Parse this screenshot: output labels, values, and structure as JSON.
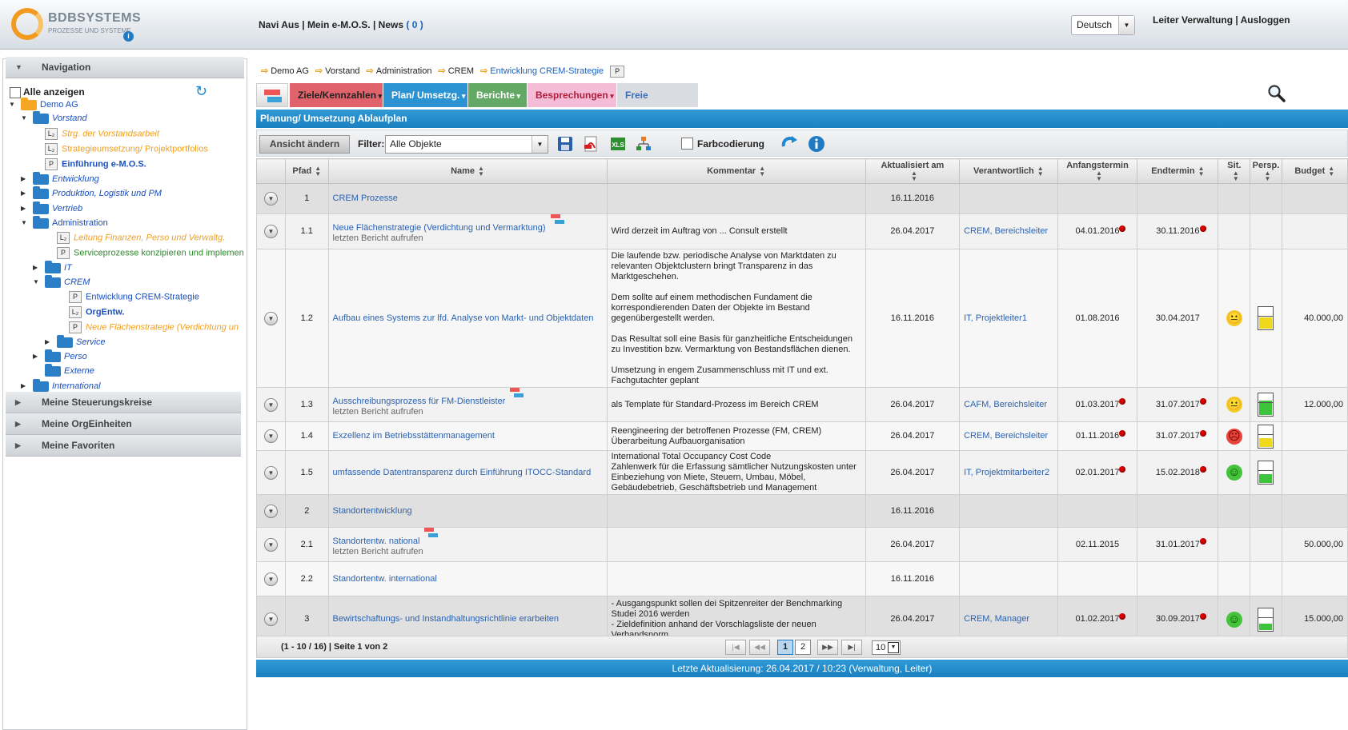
{
  "header": {
    "logo_text": "BDBSYSTEMS",
    "logo_sub": "PROZESSE UND SYSTEME",
    "nav": {
      "navi_aus": "Navi Aus",
      "sep1": " | ",
      "mein": "Mein e-M.O.S.",
      "sep2": " | ",
      "news": "News",
      "news_count": "( 0 )"
    },
    "language": "Deutsch",
    "user": "Leiter Verwaltung",
    "user_sep": " | ",
    "logout": "Ausloggen"
  },
  "sidebar": {
    "nav_title": "Navigation",
    "show_all": "Alle anzeigen",
    "tree": [
      {
        "label": "Demo AG",
        "type": "folder-orange",
        "color": "blue",
        "toggle": "▼"
      },
      {
        "label": "Vorstand",
        "type": "folder",
        "color": "blue-i",
        "toggle": "▼"
      },
      {
        "label": "Strg. der Vorstandsarbeit",
        "type": "L",
        "color": "orange"
      },
      {
        "label": "Strategieumsetzung/ Projektportfolios",
        "type": "L",
        "color": "orange-n"
      },
      {
        "label": "Einführung e-M.O.S.",
        "type": "P",
        "color": "blue-b"
      },
      {
        "label": "Entwicklung",
        "type": "folder",
        "color": "blue-i",
        "toggle": "▶"
      },
      {
        "label": "Produktion, Logistik und PM",
        "type": "folder",
        "color": "blue-i",
        "toggle": "▶"
      },
      {
        "label": "Vertrieb",
        "type": "folder",
        "color": "blue-i",
        "toggle": "▶"
      },
      {
        "label": "Administration",
        "type": "folder",
        "color": "blue-n",
        "toggle": "▼"
      },
      {
        "label": "Leitung Finanzen, Perso und Verwaltg.",
        "type": "L",
        "color": "orange"
      },
      {
        "label": "Serviceprozesse konzipieren und implemen",
        "type": "P",
        "color": "green"
      },
      {
        "label": "IT",
        "type": "folder",
        "color": "blue-i",
        "toggle": "▶"
      },
      {
        "label": "CREM",
        "type": "folder",
        "color": "blue-i",
        "toggle": "▼"
      },
      {
        "label": "Entwicklung CREM-Strategie",
        "type": "P",
        "color": "blue-n"
      },
      {
        "label": "OrgEntw.",
        "type": "L",
        "color": "blue-b"
      },
      {
        "label": "Neue Flächenstrategie (Verdichtung un",
        "type": "P",
        "color": "orange"
      },
      {
        "label": "Service",
        "type": "folder",
        "color": "blue-i",
        "toggle": "▶"
      },
      {
        "label": "Perso",
        "type": "folder",
        "color": "blue-i",
        "toggle": "▶"
      },
      {
        "label": "Externe",
        "type": "folder",
        "color": "blue-i",
        "toggle": ""
      },
      {
        "label": "International",
        "type": "folder",
        "color": "blue-i",
        "toggle": "▶"
      }
    ],
    "sections": [
      "Meine Steuerungskreise",
      "Meine OrgEinheiten",
      "Meine Favoriten"
    ]
  },
  "breadcrumb": [
    "Demo AG",
    "Vorstand",
    "Administration",
    "CREM",
    "Entwicklung CREM-Strategie"
  ],
  "breadcrumb_doc": "P",
  "menu": [
    {
      "label": "Ziele/Kennzahlen",
      "color": "#e0626a"
    },
    {
      "label": "Plan/ Umsetzg.",
      "color": "#2c93d3"
    },
    {
      "label": "Berichte",
      "color": "#64a866"
    },
    {
      "label": "Besprechungen",
      "color": "#f4bcd6"
    },
    {
      "label": "Freie Dokumente",
      "color": "#d9dde2"
    }
  ],
  "panel_title": "Planung/ Umsetzung Ablaufplan",
  "toolbar": {
    "view_button": "Ansicht ändern",
    "filter_label": "Filter:",
    "filter_value": "Alle Objekte",
    "color_coding": "Farbcodierung",
    "xls": "XLS"
  },
  "columns": [
    "Pfad",
    "Name",
    "Kommentar",
    "Aktualisiert am",
    "Verantwortlich",
    "Anfangstermin",
    "Endtermin",
    "Sit.",
    "Persp.",
    "Budget"
  ],
  "rows": [
    {
      "path": "1",
      "name": "CREM Prozesse",
      "sub": "",
      "comment": "",
      "updated": "16.11.2016",
      "resp": "",
      "start": "",
      "end": "",
      "sit": "",
      "gauge": "",
      "budget": "",
      "group": true
    },
    {
      "path": "1.1",
      "name": "Neue Flächenstrategie (Verdichtung und Vermarktung)",
      "sub": "letzten Bericht aufrufen",
      "comment": "Wird derzeit im Auftrag von ... Consult erstellt",
      "updated": "26.04.2017",
      "resp": "CREM, Bereichsleiter",
      "start": "04.01.2016",
      "start_dot": true,
      "end": "30.11.2016",
      "end_dot": true,
      "sit": "",
      "gauge": "",
      "budget": ""
    },
    {
      "path": "1.2",
      "name": "Aufbau eines Systems zur lfd. Analyse von Markt- und Objektdaten",
      "sub": "",
      "comment": "Die laufende bzw. periodische Analyse von Marktdaten zu relevanten Objektclustern bringt Transparenz in das Marktgeschehen.\n\nDem sollte auf einem methodischen Fundament die korrespondierenden Daten der Objekte im Bestand gegenübergestellt werden.\n\nDas Resultat soll eine Basis für ganzheitliche Entscheidungen zu Investition bzw. Vermarktung von Bestandsflächen dienen.\n\nUmsetzung in engem Zusammenschluss mit IT und ext. Fachgutachter geplant",
      "updated": "16.11.2016",
      "resp": "IT, Projektleiter1",
      "start": "01.08.2016",
      "end": "30.04.2017",
      "sit": "yellow",
      "gauge": "yellow",
      "gauge_level": 0.5,
      "budget": "40.000,00"
    },
    {
      "path": "1.3",
      "name": "Ausschreibungsprozess für FM-Dienstleister",
      "sub": "letzten Bericht aufrufen",
      "comment": "als Template für Standard-Prozess im Bereich CREM",
      "updated": "26.04.2017",
      "resp": "CAFM, Bereichsleiter",
      "start": "01.03.2017",
      "start_dot": true,
      "end": "31.07.2017",
      "end_dot": true,
      "sit": "yellow",
      "gauge": "green",
      "gauge_level": 0.65,
      "budget": "12.000,00"
    },
    {
      "path": "1.4",
      "name": "Exzellenz im Betriebsstättenmanagement",
      "sub": "",
      "comment": "Reengineering der betroffenen Prozesse (FM, CREM)\nÜberarbeitung Aufbauorganisation",
      "updated": "26.04.2017",
      "resp": "CREM, Bereichsleiter",
      "start": "01.11.2016",
      "start_dot": true,
      "end": "31.07.2017",
      "end_dot": true,
      "sit": "red",
      "gauge": "yellow",
      "gauge_level": 0.4,
      "budget": ""
    },
    {
      "path": "1.5",
      "name": "umfassende Datentransparenz durch Einführung ITOCC-Standard",
      "sub": "",
      "comment": "International Total Occupancy Cost Code\nZahlenwerk für die Erfassung sämtlicher Nutzungskosten unter Einbeziehung von Miete, Steuern, Umbau, Möbel, Gebäudebetrieb, Geschäftsbetrieb und Management",
      "updated": "26.04.2017",
      "resp": "IT, Projektmitarbeiter2",
      "start": "02.01.2017",
      "start_dot": true,
      "end": "15.02.2018",
      "end_dot": true,
      "sit": "green",
      "gauge": "green",
      "gauge_level": 0.4,
      "budget": ""
    },
    {
      "path": "2",
      "name": "Standortentwicklung",
      "sub": "",
      "comment": "",
      "updated": "16.11.2016",
      "resp": "",
      "start": "",
      "end": "",
      "sit": "",
      "gauge": "",
      "budget": "",
      "group": true
    },
    {
      "path": "2.1",
      "name": "Standortentw. national",
      "sub": "letzten Bericht aufrufen",
      "comment": "",
      "updated": "26.04.2017",
      "resp": "",
      "start": "02.11.2015",
      "end": "31.01.2017",
      "end_dot": true,
      "sit": "",
      "gauge": "",
      "budget": "50.000,00"
    },
    {
      "path": "2.2",
      "name": "Standortentw. international",
      "sub": "",
      "comment": "",
      "updated": "16.11.2016",
      "resp": "",
      "start": "",
      "end": "",
      "sit": "",
      "gauge": "",
      "budget": ""
    },
    {
      "path": "3",
      "name": "Bewirtschaftungs- und Instandhaltungsrichtlinie erarbeiten",
      "sub": "",
      "comment": "- Ausgangspunkt sollen dei Spitzenreiter der Benchmarking Studei 2016 werden\n- Zieldefinition anhand der Vorschlagsliste der neuen Verbandsnorm",
      "updated": "26.04.2017",
      "resp": "CREM, Manager",
      "start": "01.02.2017",
      "start_dot": true,
      "end": "30.09.2017",
      "end_dot": true,
      "sit": "green",
      "gauge": "green",
      "gauge_level": 0.3,
      "budget": "15.000,00",
      "group": true
    }
  ],
  "pager": {
    "info": "(1 - 10 / 16) | Seite 1 von 2",
    "pages": [
      "1",
      "2"
    ],
    "page_size": "10"
  },
  "footer": "Letzte Aktualisierung: 26.04.2017 / 10:23 (Verwaltung, Leiter)"
}
